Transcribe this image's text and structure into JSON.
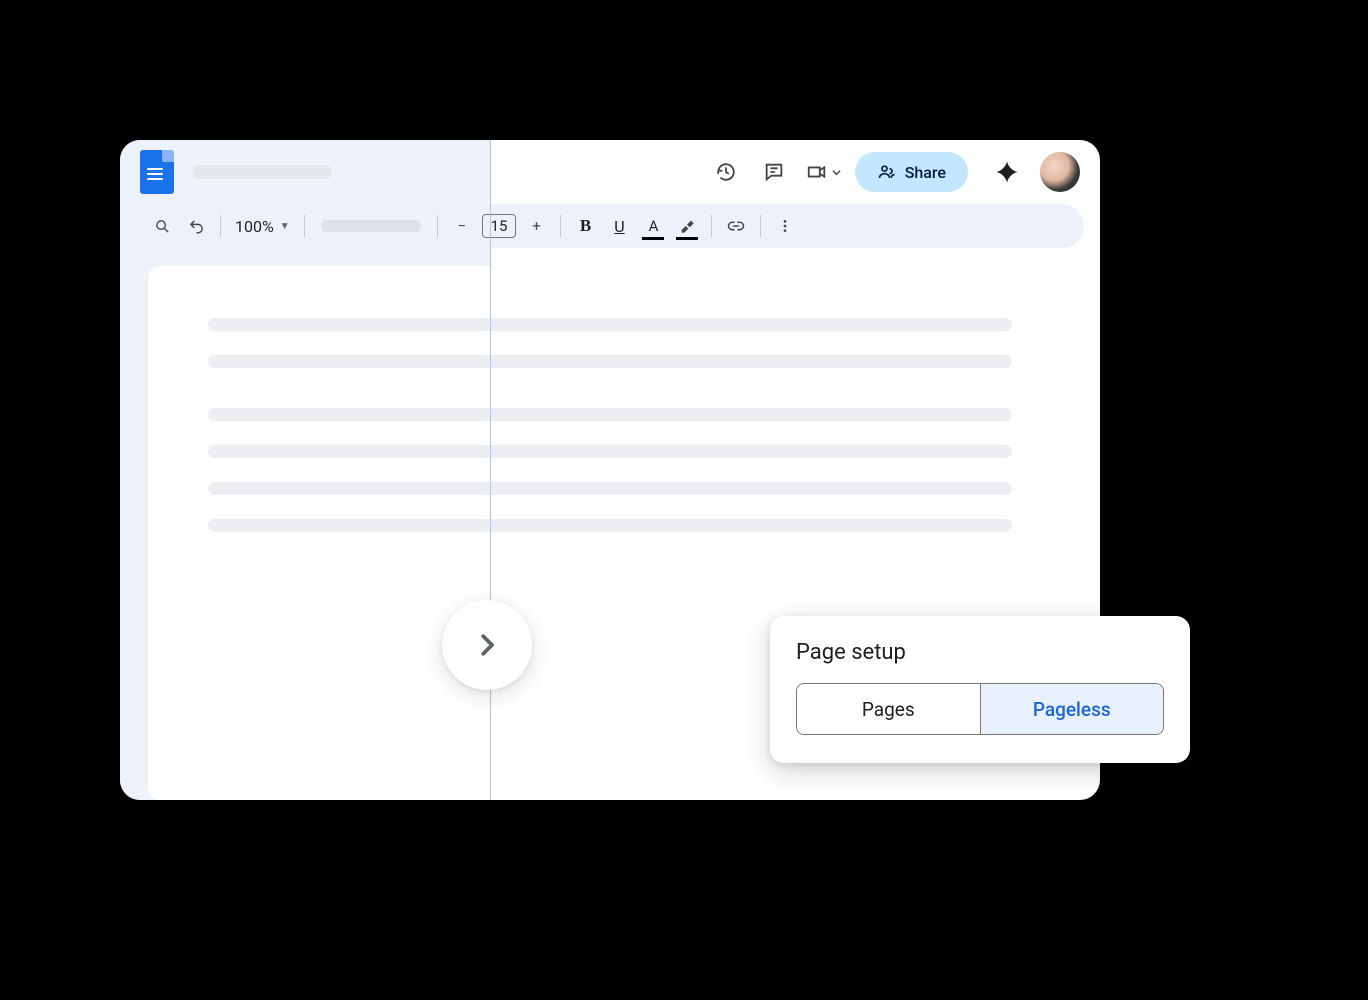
{
  "header": {
    "share_label": "Share"
  },
  "toolbar": {
    "zoom": "100%",
    "font_size": "15"
  },
  "popover": {
    "title": "Page setup",
    "option_pages": "Pages",
    "option_pageless": "Pageless"
  }
}
